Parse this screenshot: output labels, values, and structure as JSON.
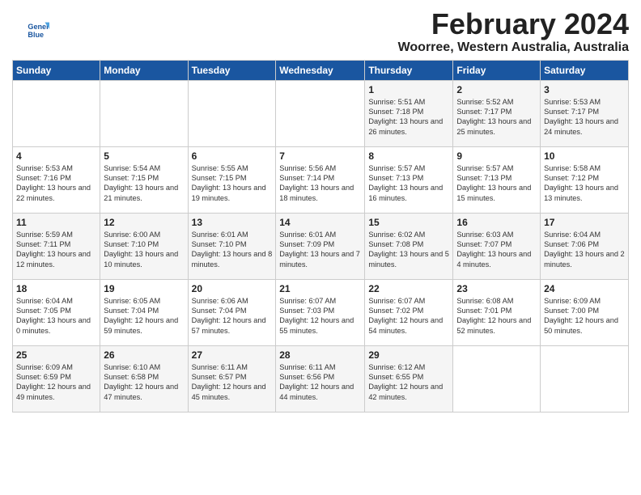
{
  "logo": {
    "line1": "General",
    "line2": "Blue"
  },
  "header": {
    "month": "February 2024",
    "location": "Woorree, Western Australia, Australia"
  },
  "days_of_week": [
    "Sunday",
    "Monday",
    "Tuesday",
    "Wednesday",
    "Thursday",
    "Friday",
    "Saturday"
  ],
  "weeks": [
    [
      {
        "day": "",
        "content": ""
      },
      {
        "day": "",
        "content": ""
      },
      {
        "day": "",
        "content": ""
      },
      {
        "day": "",
        "content": ""
      },
      {
        "day": "1",
        "content": "Sunrise: 5:51 AM\nSunset: 7:18 PM\nDaylight: 13 hours\nand 26 minutes."
      },
      {
        "day": "2",
        "content": "Sunrise: 5:52 AM\nSunset: 7:17 PM\nDaylight: 13 hours\nand 25 minutes."
      },
      {
        "day": "3",
        "content": "Sunrise: 5:53 AM\nSunset: 7:17 PM\nDaylight: 13 hours\nand 24 minutes."
      }
    ],
    [
      {
        "day": "4",
        "content": "Sunrise: 5:53 AM\nSunset: 7:16 PM\nDaylight: 13 hours\nand 22 minutes."
      },
      {
        "day": "5",
        "content": "Sunrise: 5:54 AM\nSunset: 7:15 PM\nDaylight: 13 hours\nand 21 minutes."
      },
      {
        "day": "6",
        "content": "Sunrise: 5:55 AM\nSunset: 7:15 PM\nDaylight: 13 hours\nand 19 minutes."
      },
      {
        "day": "7",
        "content": "Sunrise: 5:56 AM\nSunset: 7:14 PM\nDaylight: 13 hours\nand 18 minutes."
      },
      {
        "day": "8",
        "content": "Sunrise: 5:57 AM\nSunset: 7:13 PM\nDaylight: 13 hours\nand 16 minutes."
      },
      {
        "day": "9",
        "content": "Sunrise: 5:57 AM\nSunset: 7:13 PM\nDaylight: 13 hours\nand 15 minutes."
      },
      {
        "day": "10",
        "content": "Sunrise: 5:58 AM\nSunset: 7:12 PM\nDaylight: 13 hours\nand 13 minutes."
      }
    ],
    [
      {
        "day": "11",
        "content": "Sunrise: 5:59 AM\nSunset: 7:11 PM\nDaylight: 13 hours\nand 12 minutes."
      },
      {
        "day": "12",
        "content": "Sunrise: 6:00 AM\nSunset: 7:10 PM\nDaylight: 13 hours\nand 10 minutes."
      },
      {
        "day": "13",
        "content": "Sunrise: 6:01 AM\nSunset: 7:10 PM\nDaylight: 13 hours\nand 8 minutes."
      },
      {
        "day": "14",
        "content": "Sunrise: 6:01 AM\nSunset: 7:09 PM\nDaylight: 13 hours\nand 7 minutes."
      },
      {
        "day": "15",
        "content": "Sunrise: 6:02 AM\nSunset: 7:08 PM\nDaylight: 13 hours\nand 5 minutes."
      },
      {
        "day": "16",
        "content": "Sunrise: 6:03 AM\nSunset: 7:07 PM\nDaylight: 13 hours\nand 4 minutes."
      },
      {
        "day": "17",
        "content": "Sunrise: 6:04 AM\nSunset: 7:06 PM\nDaylight: 13 hours\nand 2 minutes."
      }
    ],
    [
      {
        "day": "18",
        "content": "Sunrise: 6:04 AM\nSunset: 7:05 PM\nDaylight: 13 hours\nand 0 minutes."
      },
      {
        "day": "19",
        "content": "Sunrise: 6:05 AM\nSunset: 7:04 PM\nDaylight: 12 hours\nand 59 minutes."
      },
      {
        "day": "20",
        "content": "Sunrise: 6:06 AM\nSunset: 7:04 PM\nDaylight: 12 hours\nand 57 minutes."
      },
      {
        "day": "21",
        "content": "Sunrise: 6:07 AM\nSunset: 7:03 PM\nDaylight: 12 hours\nand 55 minutes."
      },
      {
        "day": "22",
        "content": "Sunrise: 6:07 AM\nSunset: 7:02 PM\nDaylight: 12 hours\nand 54 minutes."
      },
      {
        "day": "23",
        "content": "Sunrise: 6:08 AM\nSunset: 7:01 PM\nDaylight: 12 hours\nand 52 minutes."
      },
      {
        "day": "24",
        "content": "Sunrise: 6:09 AM\nSunset: 7:00 PM\nDaylight: 12 hours\nand 50 minutes."
      }
    ],
    [
      {
        "day": "25",
        "content": "Sunrise: 6:09 AM\nSunset: 6:59 PM\nDaylight: 12 hours\nand 49 minutes."
      },
      {
        "day": "26",
        "content": "Sunrise: 6:10 AM\nSunset: 6:58 PM\nDaylight: 12 hours\nand 47 minutes."
      },
      {
        "day": "27",
        "content": "Sunrise: 6:11 AM\nSunset: 6:57 PM\nDaylight: 12 hours\nand 45 minutes."
      },
      {
        "day": "28",
        "content": "Sunrise: 6:11 AM\nSunset: 6:56 PM\nDaylight: 12 hours\nand 44 minutes."
      },
      {
        "day": "29",
        "content": "Sunrise: 6:12 AM\nSunset: 6:55 PM\nDaylight: 12 hours\nand 42 minutes."
      },
      {
        "day": "",
        "content": ""
      },
      {
        "day": "",
        "content": ""
      }
    ]
  ]
}
